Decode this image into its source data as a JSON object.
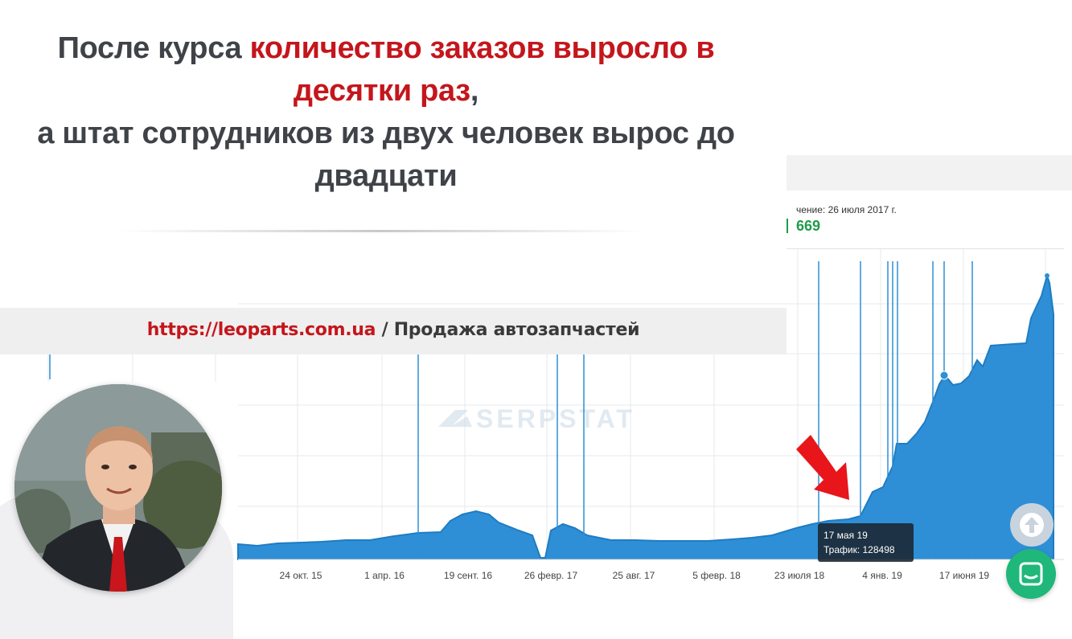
{
  "headline": {
    "part1": "После курса ",
    "highlight": "количество заказов выросло в десятки раз",
    "comma": ",",
    "part2": "а штат сотрудников из двух человек вырос до двадцати"
  },
  "site": {
    "url": "https://leoparts.com.ua",
    "separator": " / ",
    "description": "Продажа автозапчастей"
  },
  "serpstat_panel": {
    "date_label": "чение: 26 июля 2017 г.",
    "value": "669",
    "watermark": "SERPSTAT",
    "x_ticks": [
      "24 окт. 15",
      "1 апр. 16",
      "19 сент. 16",
      "26 февр. 17",
      "25 авг. 17",
      "5 февр. 18",
      "23 июля 18",
      "4 янв. 19",
      "17 июня 19"
    ],
    "tooltip": {
      "date": "17 мая 19",
      "traffic_label": "Трафик: ",
      "traffic_value": "128498"
    }
  },
  "colors": {
    "accent_red": "#c4161c",
    "chart_blue": "#2e8fd6",
    "value_green": "#1e9c4a",
    "text_dark": "#3f4348"
  },
  "icons": {
    "scroll_up": "arrow-up-icon",
    "chat": "chat-icon",
    "pointer": "red-arrow-icon"
  }
}
